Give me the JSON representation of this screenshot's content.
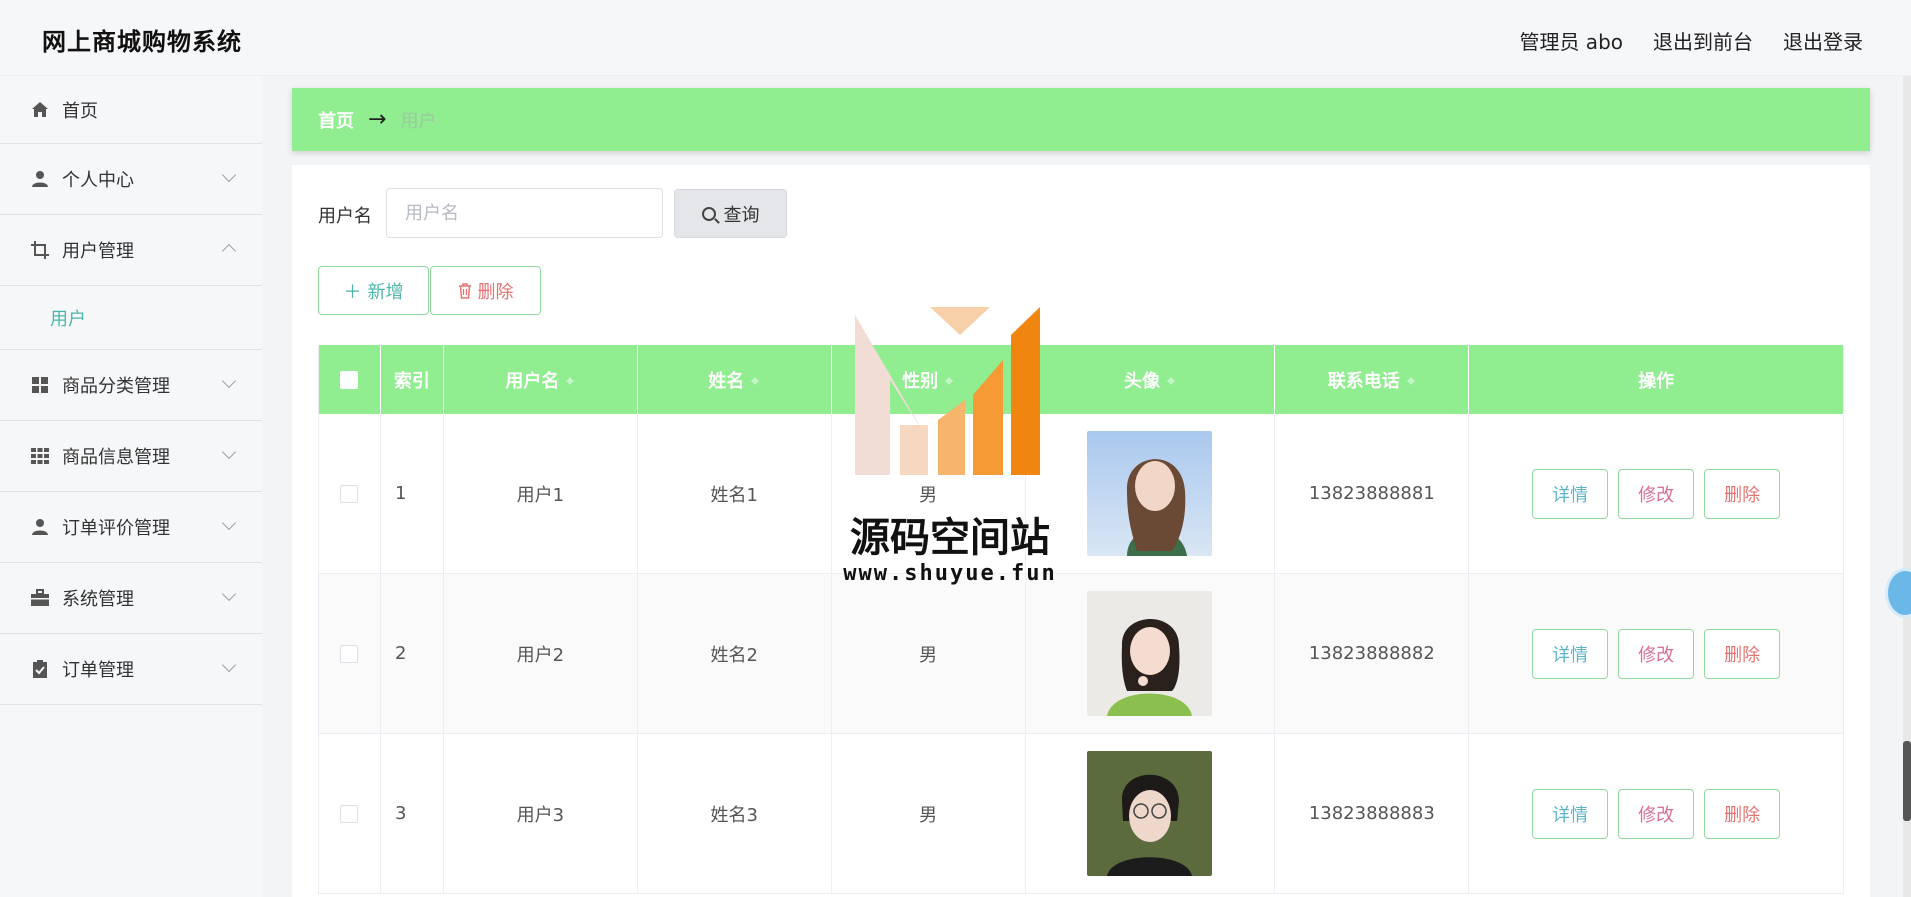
{
  "app": {
    "title": "网上商城购物系统",
    "user_label": "管理员 abo",
    "to_front_label": "退出到前台",
    "logout_label": "退出登录"
  },
  "sidebar": {
    "items": [
      {
        "label": "首页",
        "icon": "home-icon"
      },
      {
        "label": "个人中心",
        "icon": "user-icon"
      },
      {
        "label": "用户管理",
        "icon": "crop-icon",
        "expanded": true,
        "children": [
          {
            "label": "用户"
          }
        ]
      },
      {
        "label": "商品分类管理",
        "icon": "grid-icon"
      },
      {
        "label": "商品信息管理",
        "icon": "grid9-icon"
      },
      {
        "label": "订单评价管理",
        "icon": "user-icon"
      },
      {
        "label": "系统管理",
        "icon": "briefcase-icon"
      },
      {
        "label": "订单管理",
        "icon": "clipboard-check-icon"
      }
    ]
  },
  "breadcrumb": {
    "home": "首页",
    "separator": "→",
    "current": "用户"
  },
  "search": {
    "label": "用户名",
    "placeholder": "用户名",
    "button_label": "查询"
  },
  "actions": {
    "add_label": "新增",
    "delete_label": "删除"
  },
  "table": {
    "columns": [
      "索引",
      "用户名",
      "姓名",
      "性别",
      "头像",
      "联系电话",
      "操作"
    ],
    "rows": [
      {
        "index": "1",
        "username": "用户1",
        "name": "姓名1",
        "gender": "男",
        "phone": "13823888881"
      },
      {
        "index": "2",
        "username": "用户2",
        "name": "姓名2",
        "gender": "男",
        "phone": "13823888882"
      },
      {
        "index": "3",
        "username": "用户3",
        "name": "姓名3",
        "gender": "男",
        "phone": "13823888883"
      }
    ],
    "row_actions": {
      "detail": "详情",
      "edit": "修改",
      "delete": "删除"
    }
  },
  "watermark": {
    "text": "源码空间站",
    "url": "www.shuyue.fun"
  },
  "colors": {
    "accent_green": "#90ee90",
    "teal": "#4db6ac",
    "danger": "#e57373"
  }
}
